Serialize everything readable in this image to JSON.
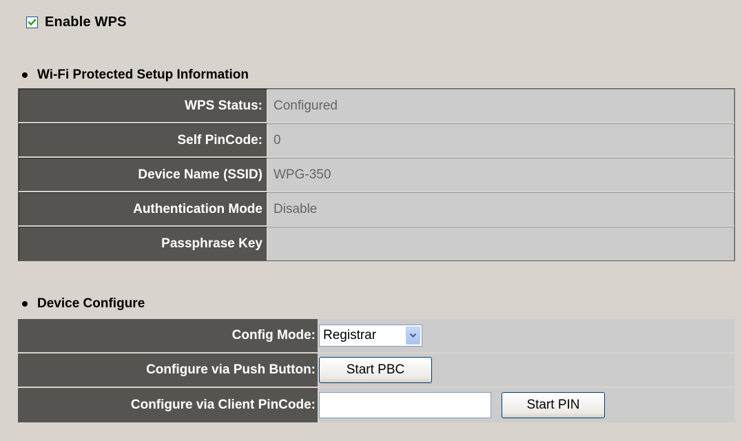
{
  "enable_wps": {
    "label": "Enable WPS",
    "checked": true
  },
  "wps_info": {
    "heading": "Wi-Fi Protected Setup Information",
    "rows": [
      {
        "label": "WPS Status:",
        "value": "Configured"
      },
      {
        "label": "Self PinCode:",
        "value": "0"
      },
      {
        "label": "Device Name (SSID)",
        "value": "WPG-350"
      },
      {
        "label": "Authentication Mode",
        "value": "Disable"
      },
      {
        "label": "Passphrase Key",
        "value": ""
      }
    ]
  },
  "device_configure": {
    "heading": "Device Configure",
    "config_mode": {
      "label": "Config Mode:",
      "selected": "Registrar"
    },
    "push_button": {
      "label": "Configure via Push Button:",
      "button": "Start PBC"
    },
    "client_pincode": {
      "label": "Configure via Client PinCode:",
      "input_value": "",
      "button": "Start PIN"
    }
  },
  "colors": {
    "background": "#d8d4cd",
    "label_cell": "#555450",
    "value_cell": "#cccccc",
    "value_text": "#666666",
    "checkbox_check": "#21a121"
  }
}
